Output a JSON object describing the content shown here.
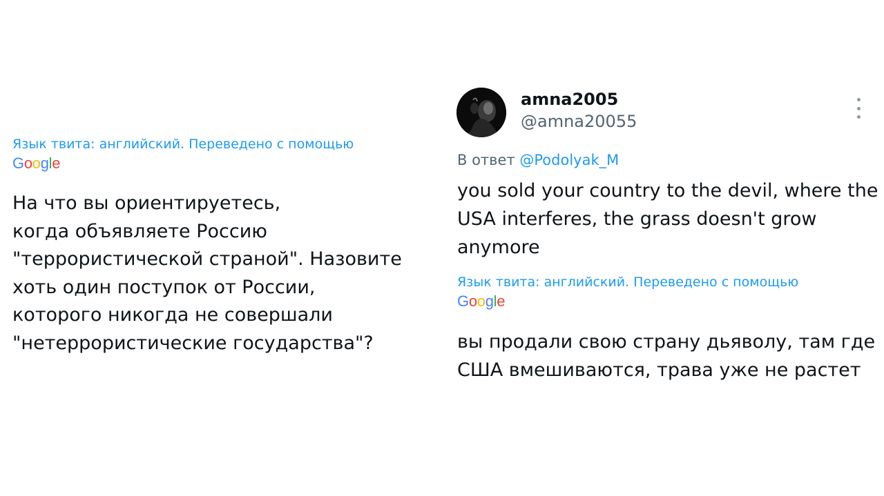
{
  "left_tweet": {
    "translation_note": "Язык твита: английский. Переведено с помощью",
    "translator_logo": "Google",
    "translated_text": "На что вы ориентируетесь,\nкогда объявляете Россию\n\"террористической страной\". Назовите\nхоть один поступок от России,\nкоторого никогда не совершали\n\"нетеррористические государства\"?"
  },
  "right_tweet": {
    "avatar_icon": "avatar-photo",
    "display_name": "amna2005",
    "handle": "@amna20055",
    "more_icon": "more-vertical-icon",
    "reply_prefix": "В ответ",
    "reply_mention": "@Podolyak_M",
    "original_text": "you sold your country to the devil, where the USA interferes, the grass doesn't grow anymore",
    "translation_note": "Язык твита: английский. Переведено с помощью",
    "translator_logo": "Google",
    "translated_text": "вы продали свою страну дьяволу, там где США вмешиваются, трава уже не растет"
  },
  "colors": {
    "text_primary": "#0f1419",
    "text_secondary": "#536471",
    "link": "#1d9bf0",
    "background": "#ffffff"
  }
}
